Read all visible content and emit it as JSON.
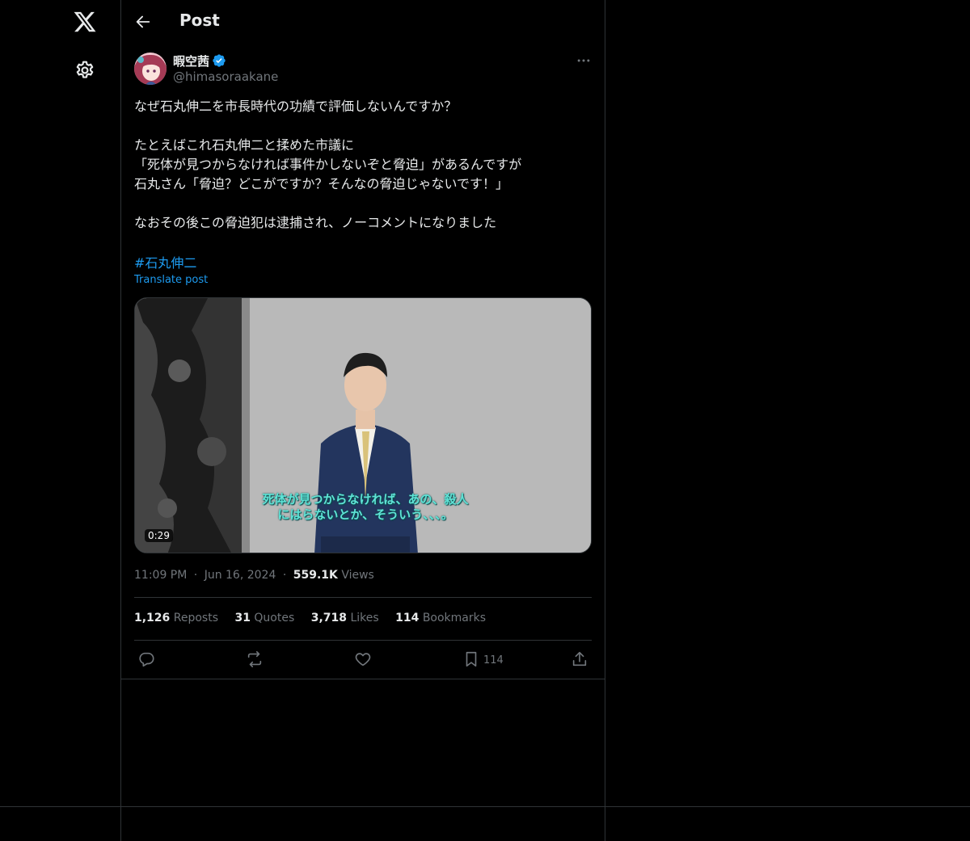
{
  "header": {
    "title": "Post"
  },
  "author": {
    "display_name": "暇空茜",
    "handle": "@himasoraakane",
    "verified": true
  },
  "post": {
    "paragraphs": [
      "なぜ石丸伸二を市長時代の功績で評価しないんですか？",
      "たとえばこれ石丸伸二と揉めた市議に\n「死体が見つからなければ事件かしないぞと脅迫」があるんですが\n石丸さん「脅迫？どこがですか？そんなの脅迫じゃないです！」",
      "なおその後この脅迫犯は逮捕され、ノーコメントになりました"
    ],
    "hashtag": "#石丸伸二",
    "translate_label": "Translate post"
  },
  "media": {
    "subtitle": "死体が見つからなければ、あの、殺人\nにはらないとか、そういう、、、。",
    "duration": "0:29"
  },
  "meta": {
    "time": "11:09 PM",
    "dot": "·",
    "date": "Jun 16, 2024",
    "views_count": "559.1K",
    "views_label": "Views"
  },
  "stats": {
    "reposts_count": "1,126",
    "reposts_label": "Reposts",
    "quotes_count": "31",
    "quotes_label": "Quotes",
    "likes_count": "3,718",
    "likes_label": "Likes",
    "bookmarks_count": "114",
    "bookmarks_label": "Bookmarks"
  },
  "actions": {
    "bookmark_count": "114"
  },
  "colors": {
    "accent": "#1d9bf0",
    "text": "#e7e9ea",
    "muted": "#71767b",
    "border": "#2f3336",
    "background": "#000000"
  }
}
